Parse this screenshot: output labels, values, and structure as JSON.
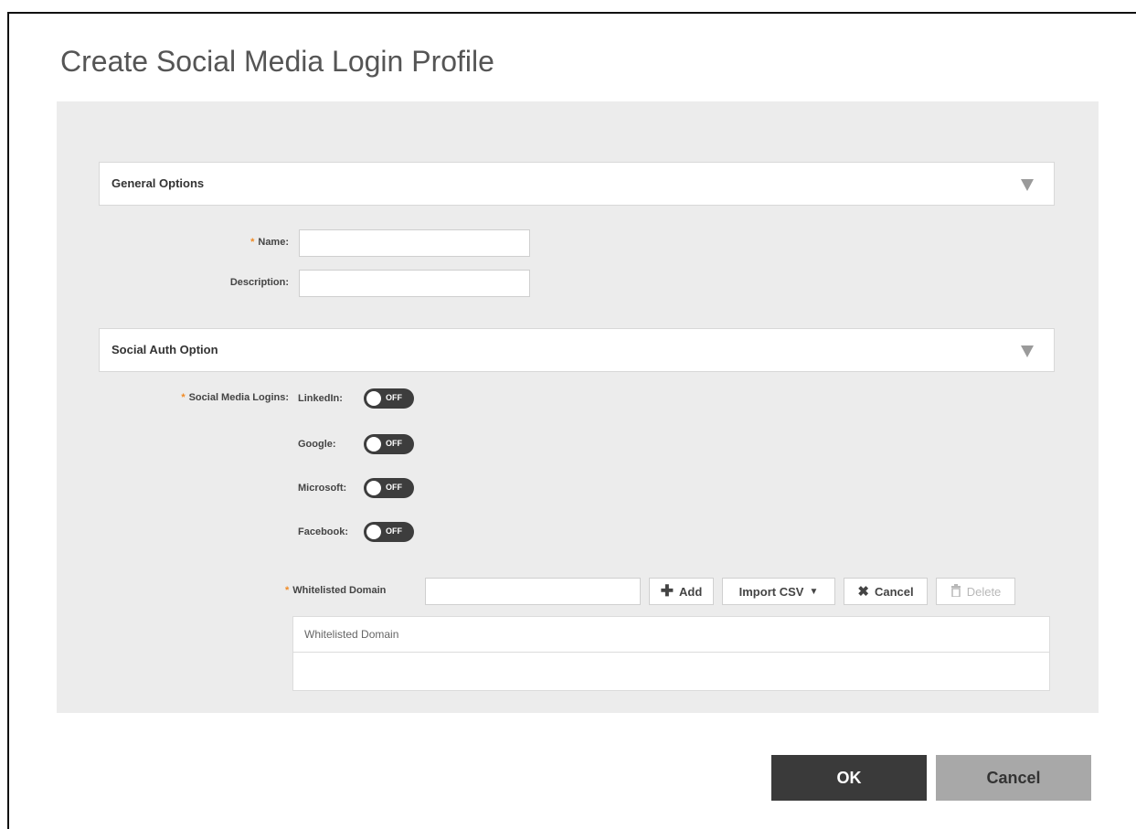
{
  "dialog": {
    "title": "Create Social Media Login Profile"
  },
  "general": {
    "header": "General Options",
    "name_label": "Name:",
    "name_value": "",
    "description_label": "Description:",
    "description_value": ""
  },
  "social": {
    "header": "Social Auth Option",
    "logins_label": "Social Media Logins:",
    "toggles": [
      {
        "label": "LinkedIn:",
        "state": "OFF"
      },
      {
        "label": "Google:",
        "state": "OFF"
      },
      {
        "label": "Microsoft:",
        "state": "OFF"
      },
      {
        "label": "Facebook:",
        "state": "OFF"
      }
    ],
    "whitelist_label": "Whitelisted Domain",
    "whitelist_value": "",
    "buttons": {
      "add": "Add",
      "import": "Import CSV",
      "cancel": "Cancel",
      "delete": "Delete"
    },
    "grid_header": "Whitelisted Domain"
  },
  "footer": {
    "ok": "OK",
    "cancel": "Cancel"
  },
  "colors": {
    "required": "#f08a24",
    "ok_bg": "#3a3a3a",
    "cancel_bg": "#a8a8a8",
    "toggle_off": "#3d3d3d"
  },
  "icons": {
    "section_toggle": "triangle-down-icon",
    "add": "plus-icon",
    "import": "caret-down-icon",
    "cancel": "x-icon",
    "delete": "trash-icon"
  }
}
